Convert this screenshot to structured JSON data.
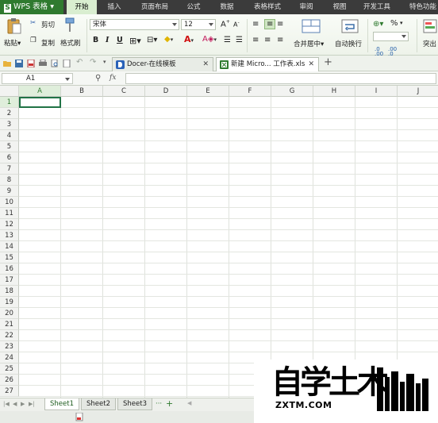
{
  "menu": {
    "app_name": "WPS 表格",
    "tabs": [
      "开始",
      "插入",
      "页面布局",
      "公式",
      "数据",
      "表格样式",
      "审阅",
      "视图",
      "开发工具",
      "特色功能"
    ]
  },
  "ribbon": {
    "paste": "粘贴",
    "cut": "剪切",
    "copy": "复制",
    "format_painter": "格式刷",
    "font_name": "宋体",
    "font_size": "12",
    "bold": "B",
    "italic": "I",
    "underline": "U",
    "merge_center": "合并居中",
    "wrap_text": "自动换行",
    "percent": "%",
    "number_format": "",
    "more": "突出"
  },
  "doc_tabs": [
    {
      "label": "Docer-在线模板"
    },
    {
      "label": "新建 Micro... 工作表.xls"
    }
  ],
  "formula_bar": {
    "cell_ref": "A1",
    "fx": "fx",
    "content": ""
  },
  "grid": {
    "columns": [
      "A",
      "B",
      "C",
      "D",
      "E",
      "F",
      "G",
      "H",
      "I",
      "J"
    ],
    "rows": [
      "1",
      "2",
      "3",
      "4",
      "5",
      "6",
      "7",
      "8",
      "9",
      "10",
      "11",
      "12",
      "13",
      "14",
      "15",
      "16",
      "17",
      "18",
      "19",
      "20",
      "21",
      "22",
      "23",
      "24",
      "25",
      "26",
      "27"
    ],
    "selected_cell": "A1"
  },
  "sheets": [
    "Sheet1",
    "Sheet2",
    "Sheet3"
  ],
  "sheet_add": "+",
  "sheet_more": "···",
  "watermark": {
    "chars": "自学土木",
    "url": "ZXTM.COM"
  },
  "colors": {
    "menubar": "#3b3b3b",
    "app_green": "#2f7a2f",
    "active_cell_border": "#217346"
  }
}
